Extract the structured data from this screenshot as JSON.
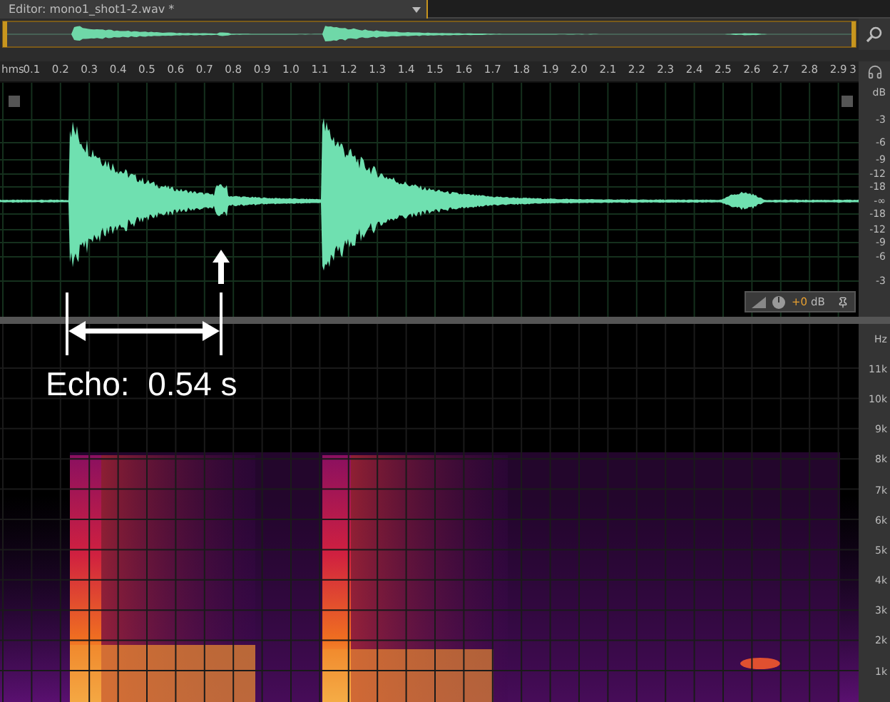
{
  "editor_tab": {
    "title": "Editor: mono1_shot1-2.wav *",
    "selected": true
  },
  "ruler": {
    "unit": "hms",
    "ticks": [
      "0.1",
      "0.2",
      "0.3",
      "0.4",
      "0.5",
      "0.6",
      "0.7",
      "0.8",
      "0.9",
      "1.0",
      "1.1",
      "1.2",
      "1.3",
      "1.4",
      "1.5",
      "1.6",
      "1.7",
      "1.8",
      "1.9",
      "2.0",
      "2.1",
      "2.2",
      "2.3",
      "2.4",
      "2.5",
      "2.6",
      "2.7",
      "2.8",
      "2.9",
      "3"
    ]
  },
  "amplitude_scale": [
    "dB",
    "-3",
    "-6",
    "-9",
    "-12",
    "-18",
    "-∞",
    "-18",
    "-12",
    "-9",
    "-6",
    "-3"
  ],
  "hud": {
    "value": "+0",
    "unit": "dB"
  },
  "frequency_scale": [
    "Hz",
    "11k",
    "10k",
    "9k",
    "8k",
    "7k",
    "6k",
    "5k",
    "4k",
    "3k",
    "2k",
    "1k"
  ],
  "annotation": {
    "label": "Echo:  0.54 s"
  }
}
